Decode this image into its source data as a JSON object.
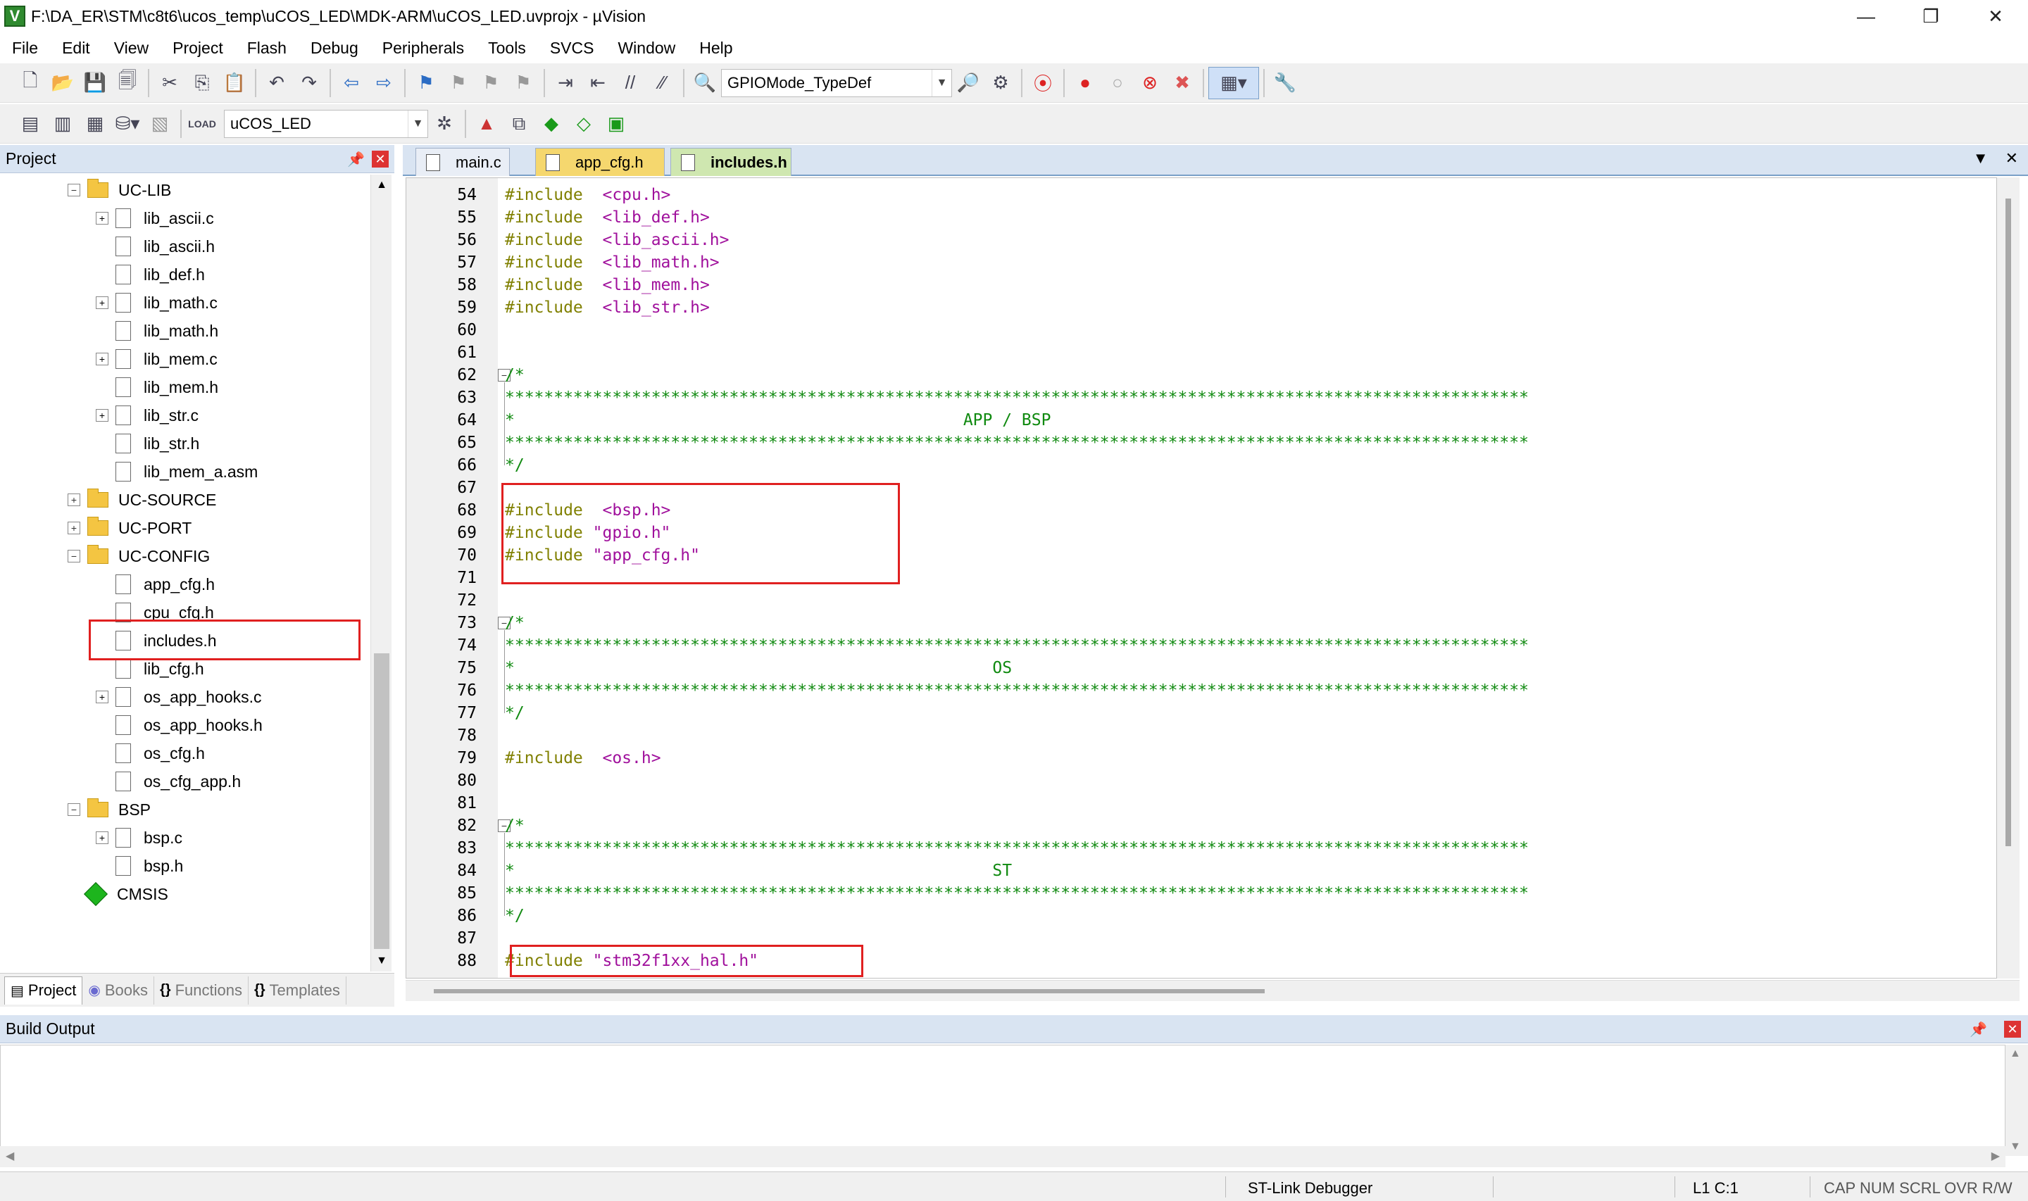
{
  "window": {
    "title": "F:\\DA_ER\\STM\\c8t6\\ucos_temp\\uCOS_LED\\MDK-ARM\\uCOS_LED.uvprojx - µVision",
    "minimize": "—",
    "restore": "❐",
    "close": "✕"
  },
  "menu": [
    "File",
    "Edit",
    "View",
    "Project",
    "Flash",
    "Debug",
    "Peripherals",
    "Tools",
    "SVCS",
    "Window",
    "Help"
  ],
  "toolbar": {
    "find_combo_value": "GPIOMode_TypeDef",
    "target_combo_value": "uCOS_LED"
  },
  "project_panel": {
    "title": "Project",
    "tree": [
      {
        "label": "UC-LIB",
        "type": "folder",
        "level": 0,
        "expander": "−"
      },
      {
        "label": "lib_ascii.c",
        "type": "file",
        "level": 1,
        "expander": "+"
      },
      {
        "label": "lib_ascii.h",
        "type": "file",
        "level": 1,
        "expander": ""
      },
      {
        "label": "lib_def.h",
        "type": "file",
        "level": 1,
        "expander": ""
      },
      {
        "label": "lib_math.c",
        "type": "file",
        "level": 1,
        "expander": "+"
      },
      {
        "label": "lib_math.h",
        "type": "file",
        "level": 1,
        "expander": ""
      },
      {
        "label": "lib_mem.c",
        "type": "file",
        "level": 1,
        "expander": "+"
      },
      {
        "label": "lib_mem.h",
        "type": "file",
        "level": 1,
        "expander": ""
      },
      {
        "label": "lib_str.c",
        "type": "file",
        "level": 1,
        "expander": "+"
      },
      {
        "label": "lib_str.h",
        "type": "file",
        "level": 1,
        "expander": ""
      },
      {
        "label": "lib_mem_a.asm",
        "type": "file",
        "level": 1,
        "expander": ""
      },
      {
        "label": "UC-SOURCE",
        "type": "folder",
        "level": 0,
        "expander": "+"
      },
      {
        "label": "UC-PORT",
        "type": "folder",
        "level": 0,
        "expander": "+"
      },
      {
        "label": "UC-CONFIG",
        "type": "folder",
        "level": 0,
        "expander": "−"
      },
      {
        "label": "app_cfg.h",
        "type": "file",
        "level": 1,
        "expander": ""
      },
      {
        "label": "cpu_cfg.h",
        "type": "file",
        "level": 1,
        "expander": ""
      },
      {
        "label": "includes.h",
        "type": "file",
        "level": 1,
        "expander": ""
      },
      {
        "label": "lib_cfg.h",
        "type": "file",
        "level": 1,
        "expander": ""
      },
      {
        "label": "os_app_hooks.c",
        "type": "file",
        "level": 1,
        "expander": "+"
      },
      {
        "label": "os_app_hooks.h",
        "type": "file",
        "level": 1,
        "expander": ""
      },
      {
        "label": "os_cfg.h",
        "type": "file",
        "level": 1,
        "expander": ""
      },
      {
        "label": "os_cfg_app.h",
        "type": "file",
        "level": 1,
        "expander": ""
      },
      {
        "label": "BSP",
        "type": "folder",
        "level": 0,
        "expander": "−"
      },
      {
        "label": "bsp.c",
        "type": "file",
        "level": 1,
        "expander": "+"
      },
      {
        "label": "bsp.h",
        "type": "file",
        "level": 1,
        "expander": ""
      },
      {
        "label": "CMSIS",
        "type": "cmsis",
        "level": 0,
        "expander": ""
      }
    ],
    "tabs": [
      {
        "label": "Project",
        "icon": "▤"
      },
      {
        "label": "Books",
        "icon": "◉"
      },
      {
        "label": "Functions",
        "icon": "{}"
      },
      {
        "label": "Templates",
        "icon": "{}"
      }
    ]
  },
  "editor": {
    "tabs": [
      "main.c",
      "app_cfg.h",
      "includes.h"
    ],
    "active_tab": "includes.h",
    "lines": [
      {
        "n": "54",
        "kind": "include",
        "kw": "#include",
        "arg": "  <cpu.h>"
      },
      {
        "n": "55",
        "kind": "include",
        "kw": "#include",
        "arg": "  <lib_def.h>"
      },
      {
        "n": "56",
        "kind": "include",
        "kw": "#include",
        "arg": "  <lib_ascii.h>"
      },
      {
        "n": "57",
        "kind": "include",
        "kw": "#include",
        "arg": "  <lib_math.h>"
      },
      {
        "n": "58",
        "kind": "include",
        "kw": "#include",
        "arg": "  <lib_mem.h>"
      },
      {
        "n": "59",
        "kind": "include",
        "kw": "#include",
        "arg": "  <lib_str.h>"
      },
      {
        "n": "60",
        "kind": "blank",
        "text": ""
      },
      {
        "n": "61",
        "kind": "blank",
        "text": ""
      },
      {
        "n": "62",
        "kind": "comment",
        "text": "/*"
      },
      {
        "n": "63",
        "kind": "comment",
        "text": "*********************************************************************************************************"
      },
      {
        "n": "64",
        "kind": "comment",
        "text": "*                                              APP / BSP"
      },
      {
        "n": "65",
        "kind": "comment",
        "text": "*********************************************************************************************************"
      },
      {
        "n": "66",
        "kind": "comment",
        "text": "*/"
      },
      {
        "n": "67",
        "kind": "blank",
        "text": ""
      },
      {
        "n": "68",
        "kind": "include",
        "kw": "#include",
        "arg": "  <bsp.h>"
      },
      {
        "n": "69",
        "kind": "include",
        "kw": "#include",
        "arg": " \"gpio.h\""
      },
      {
        "n": "70",
        "kind": "include",
        "kw": "#include",
        "arg": " \"app_cfg.h\""
      },
      {
        "n": "71",
        "kind": "blank",
        "text": ""
      },
      {
        "n": "72",
        "kind": "blank",
        "text": ""
      },
      {
        "n": "73",
        "kind": "comment",
        "text": "/*"
      },
      {
        "n": "74",
        "kind": "comment",
        "text": "*********************************************************************************************************"
      },
      {
        "n": "75",
        "kind": "comment",
        "text": "*                                                 OS"
      },
      {
        "n": "76",
        "kind": "comment",
        "text": "*********************************************************************************************************"
      },
      {
        "n": "77",
        "kind": "comment",
        "text": "*/"
      },
      {
        "n": "78",
        "kind": "blank",
        "text": ""
      },
      {
        "n": "79",
        "kind": "include",
        "kw": "#include",
        "arg": "  <os.h>"
      },
      {
        "n": "80",
        "kind": "blank",
        "text": ""
      },
      {
        "n": "81",
        "kind": "blank",
        "text": ""
      },
      {
        "n": "82",
        "kind": "comment",
        "text": "/*"
      },
      {
        "n": "83",
        "kind": "comment",
        "text": "*********************************************************************************************************"
      },
      {
        "n": "84",
        "kind": "comment",
        "text": "*                                                 ST"
      },
      {
        "n": "85",
        "kind": "comment",
        "text": "*********************************************************************************************************"
      },
      {
        "n": "86",
        "kind": "comment",
        "text": "*/"
      },
      {
        "n": "87",
        "kind": "blank",
        "text": ""
      },
      {
        "n": "88",
        "kind": "include",
        "kw": "#include",
        "arg": " \"stm32f1xx_hal.h\""
      }
    ]
  },
  "build_output": {
    "title": "Build Output"
  },
  "status": {
    "debugger": "ST-Link Debugger",
    "position": "L1 C:1",
    "flags": "CAP  NUM  SCRL  OVR  R/W"
  },
  "colors": {
    "keyword": "#808000",
    "string": "#a0109c",
    "comment": "#108a10",
    "highlight": "#e02020"
  }
}
